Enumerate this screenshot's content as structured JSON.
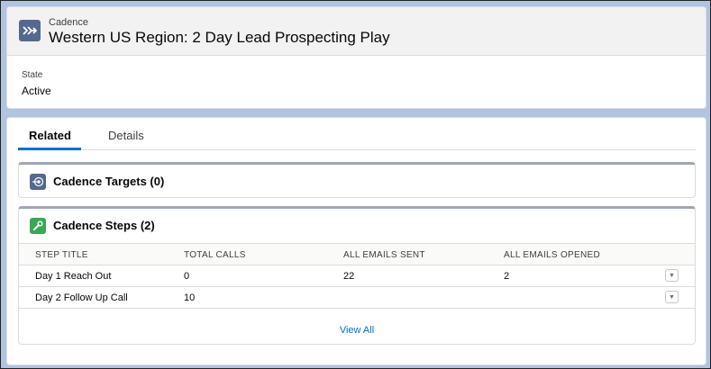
{
  "header": {
    "object_type": "Cadence",
    "title": "Western US Region: 2 Day Lead Prospecting Play",
    "icon": "cadence-arrow-icon"
  },
  "highlights": {
    "state_label": "State",
    "state_value": "Active"
  },
  "tabs": [
    {
      "label": "Related",
      "active": true
    },
    {
      "label": "Details",
      "active": false
    }
  ],
  "related": {
    "targets": {
      "title": "Cadence Targets (0)",
      "icon": "target-icon",
      "icon_color": "#54698d"
    },
    "steps": {
      "title": "Cadence Steps (2)",
      "icon": "wrench-icon",
      "icon_color": "#3ba755",
      "columns": [
        "STEP TITLE",
        "TOTAL CALLS",
        "ALL EMAILS SENT",
        "ALL EMAILS OPENED"
      ],
      "rows": [
        {
          "step_title": "Day 1 Reach Out",
          "total_calls": "0",
          "emails_sent": "22",
          "emails_opened": "2"
        },
        {
          "step_title": "Day 2 Follow Up Call",
          "total_calls": "10",
          "emails_sent": "",
          "emails_opened": ""
        }
      ],
      "view_all": "View All"
    }
  }
}
